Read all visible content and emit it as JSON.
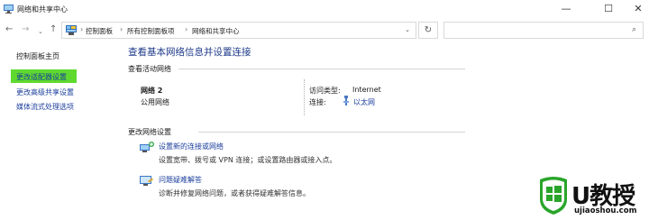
{
  "window": {
    "title": "网络和共享中心",
    "minimize_glyph": "—",
    "maximize_glyph": "☐",
    "close_glyph": "✕"
  },
  "address_bar": {
    "back_glyph": "←",
    "forward_glyph": "→",
    "dropdown_glyph": "⌄",
    "up_glyph": "↑",
    "icon": "control-panel-icon",
    "breadcrumbs": [
      "控制面板",
      "所有控制面板项",
      "网络和共享中心"
    ],
    "separator": "›",
    "refresh_glyph": "↻",
    "search_placeholder": "",
    "search_glyph": "⌕"
  },
  "sidebar": {
    "home": "控制面板主页",
    "items": [
      {
        "label": "更改适配器设置",
        "selected": true
      },
      {
        "label": "更改高级共享设置",
        "selected": false
      },
      {
        "label": "媒体流式处理选项",
        "selected": false
      }
    ],
    "selected_color": "#5fd92f"
  },
  "main": {
    "title": "查看基本网络信息并设置连接",
    "active_section": "查看活动网络",
    "network": {
      "name": "网络 2",
      "type": "公用网络",
      "access_type_label": "访问类型:",
      "access_type_value": "Internet",
      "connection_label": "连接:",
      "connection_value": "以太网",
      "connection_icon": "ethernet-icon"
    },
    "change_section": "更改网络设置",
    "tasks": [
      {
        "link": "设置新的连接或网络",
        "desc": "设置宽带、拨号或 VPN 连接；或设置路由器或接入点。",
        "icon": "new-connection-icon"
      },
      {
        "link": "问题疑难解答",
        "desc": "诊断并修复网络问题，或者获得疑难解答信息。",
        "icon": "troubleshoot-icon"
      }
    ],
    "link_color": "#1a3e9c"
  },
  "watermark": {
    "text": "U教授",
    "url": "ujiaoshou.com",
    "accent": "#2aa52a"
  }
}
